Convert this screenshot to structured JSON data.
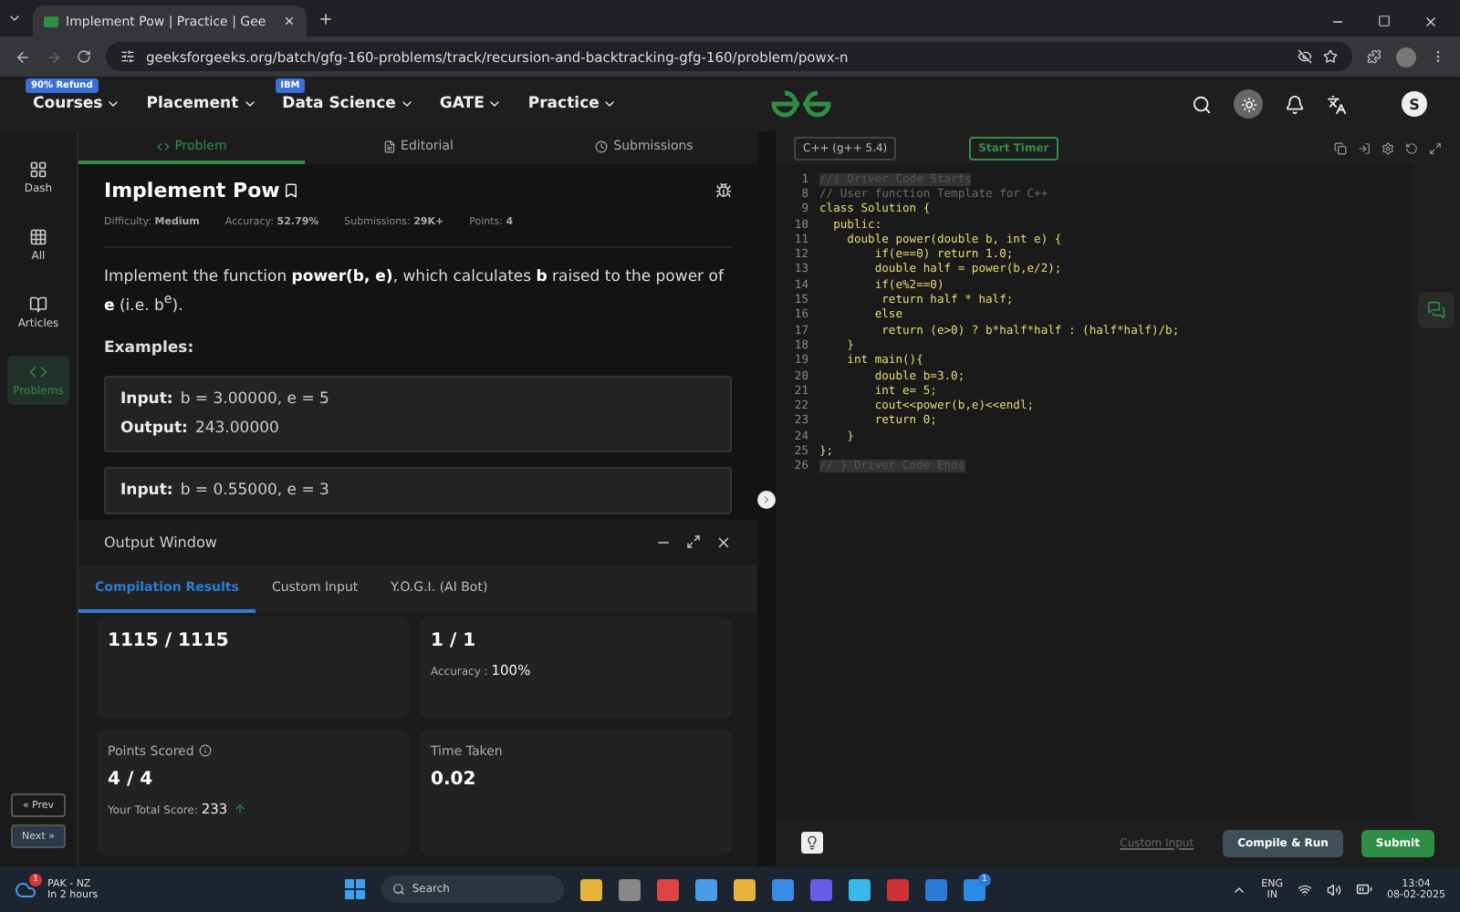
{
  "browser": {
    "tab_title": "Implement Pow | Practice | Gee",
    "url": "geeksforgeeks.org/batch/gfg-160-problems/track/recursion-and-backtracking-gfg-160/problem/powx-n"
  },
  "site_nav": {
    "items": [
      {
        "label": "Courses",
        "badge": "90% Refund"
      },
      {
        "label": "Placement"
      },
      {
        "label": "Data Science",
        "badge": "IBM"
      },
      {
        "label": "GATE"
      },
      {
        "label": "Practice"
      }
    ],
    "avatar": "S"
  },
  "sidebar": {
    "items": [
      {
        "label": "Dash",
        "selected": false
      },
      {
        "label": "All",
        "selected": false
      },
      {
        "label": "Articles",
        "selected": false
      },
      {
        "label": "Problems",
        "selected": true
      }
    ],
    "prev": "« Prev",
    "next": "Next »"
  },
  "problem_tabs": [
    {
      "label": "Problem",
      "selected": true
    },
    {
      "label": "Editorial",
      "selected": false
    },
    {
      "label": "Submissions",
      "selected": false
    }
  ],
  "problem": {
    "title": "Implement Pow",
    "meta": [
      {
        "label": "Difficulty:",
        "value": "Medium"
      },
      {
        "label": "Accuracy:",
        "value": "52.79%"
      },
      {
        "label": "Submissions:",
        "value": "29K+"
      },
      {
        "label": "Points:",
        "value": "4"
      }
    ],
    "description": "Implement the function **power(b, e)**, which calculates **b** raised to the power of **e** (i.e. b$^{e}$).",
    "examples_heading": "Examples:",
    "examples": [
      {
        "lines": [
          {
            "label": "Input:",
            "value": "b = 3.00000, e = 5"
          },
          {
            "label": "Output:",
            "value": "243.00000"
          }
        ]
      },
      {
        "lines": [
          {
            "label": "Input:",
            "value": "b = 0.55000, e = 3"
          }
        ]
      }
    ]
  },
  "output_window": {
    "title": "Output Window",
    "tabs": [
      {
        "label": "Compilation Results",
        "selected": true
      },
      {
        "label": "Custom Input",
        "selected": false
      },
      {
        "label": "Y.O.G.I. (AI Bot)",
        "selected": false
      }
    ],
    "cards": [
      {
        "value": "1115 / 1115"
      },
      {
        "value": "1 / 1",
        "note_label": "Accuracy :",
        "note_value": "100%"
      },
      {
        "label": "Points Scored",
        "value": "4 / 4",
        "note_label": "Your Total Score:",
        "note_value": "233"
      },
      {
        "label": "Time Taken",
        "value": "0.02"
      }
    ]
  },
  "editor": {
    "language": "C++ (g++ 5.4)",
    "timer": "Start Timer",
    "lines": [
      {
        "number": "1",
        "kind": "folded",
        "text": "//{ Driver Code Starts"
      },
      {
        "number": "8",
        "kind": "comment",
        "text": "// User function Template for C++"
      },
      {
        "number": "9",
        "kind": "code",
        "text": "class Solution {"
      },
      {
        "number": "10",
        "kind": "code",
        "text": "  public:"
      },
      {
        "number": "11",
        "kind": "code",
        "text": "    double power(double b, int e) {"
      },
      {
        "number": "12",
        "kind": "code",
        "text": "        if(e==0) return 1.0;"
      },
      {
        "number": "13",
        "kind": "code",
        "text": "        double half = power(b,e/2);"
      },
      {
        "number": "14",
        "kind": "code",
        "text": "        if(e%2==0)"
      },
      {
        "number": "15",
        "kind": "code",
        "text": "         return half * half;"
      },
      {
        "number": "16",
        "kind": "code",
        "text": "        else"
      },
      {
        "number": "17",
        "kind": "code",
        "text": "         return (e>0) ? b*half*half : (half*half)/b;"
      },
      {
        "number": "18",
        "kind": "code",
        "text": "    }"
      },
      {
        "number": "19",
        "kind": "code",
        "text": "    int main(){"
      },
      {
        "number": "20",
        "kind": "code",
        "text": "        double b=3.0;"
      },
      {
        "number": "21",
        "kind": "code",
        "text": "        int e= 5;"
      },
      {
        "number": "22",
        "kind": "code",
        "text": "        cout<<power(b,e)<<endl;"
      },
      {
        "number": "23",
        "kind": "code",
        "text": "        return 0;"
      },
      {
        "number": "24",
        "kind": "code",
        "text": "    }"
      },
      {
        "number": "25",
        "kind": "code",
        "text": "};"
      },
      {
        "number": "26",
        "kind": "folded",
        "text": "// } Driver Code Ends"
      }
    ],
    "custom_input": "Custom Input",
    "compile": "Compile & Run",
    "submit": "Submit"
  },
  "taskbar": {
    "weather_title": "PAK - NZ",
    "weather_sub": "In 2 hours",
    "weather_badge": "1",
    "search": "Search",
    "linkedin_badge": "1",
    "lang": "ENG",
    "region": "IN",
    "time": "13:04",
    "date": "08-02-2025"
  }
}
